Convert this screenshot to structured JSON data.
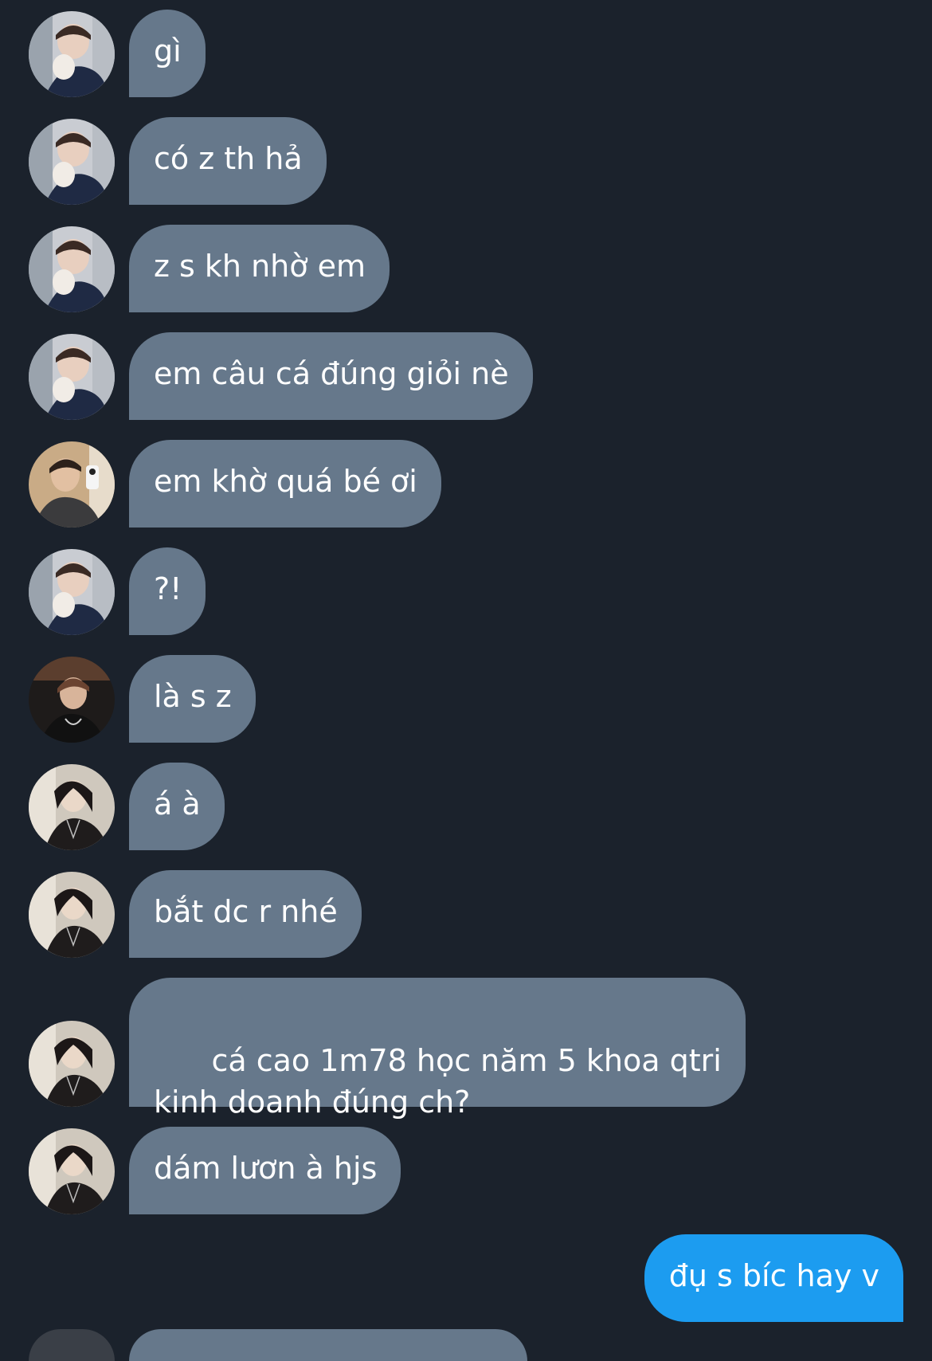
{
  "conversation": {
    "messages": [
      {
        "text": "gì",
        "direction": "incoming",
        "avatar": "avatar-a"
      },
      {
        "text": "có z th hả",
        "direction": "incoming",
        "avatar": "avatar-a"
      },
      {
        "text": "z s kh nhờ em",
        "direction": "incoming",
        "avatar": "avatar-a"
      },
      {
        "text": "em câu cá đúng giỏi nè",
        "direction": "incoming",
        "avatar": "avatar-a"
      },
      {
        "text": "em khờ quá bé ơi",
        "direction": "incoming",
        "avatar": "avatar-b"
      },
      {
        "text": "?!",
        "direction": "incoming",
        "avatar": "avatar-a"
      },
      {
        "text": "là s z",
        "direction": "incoming",
        "avatar": "avatar-c"
      },
      {
        "text": "á à",
        "direction": "incoming",
        "avatar": "avatar-d"
      },
      {
        "text": "bắt dc r nhé",
        "direction": "incoming",
        "avatar": "avatar-d"
      },
      {
        "text": "cá cao 1m78 học năm 5 khoa qtri\nkinh doanh đúng ch?",
        "direction": "incoming",
        "avatar": "avatar-d"
      },
      {
        "text": "dám lươn à hjs",
        "direction": "incoming",
        "avatar": "avatar-d"
      },
      {
        "text": "đụ s bíc hay v",
        "direction": "outgoing",
        "avatar": ""
      }
    ]
  },
  "colors": {
    "background": "#1b222c",
    "incoming_bubble": "#66788b",
    "outgoing_bubble": "#1c9cf0",
    "text": "#ffffff"
  }
}
